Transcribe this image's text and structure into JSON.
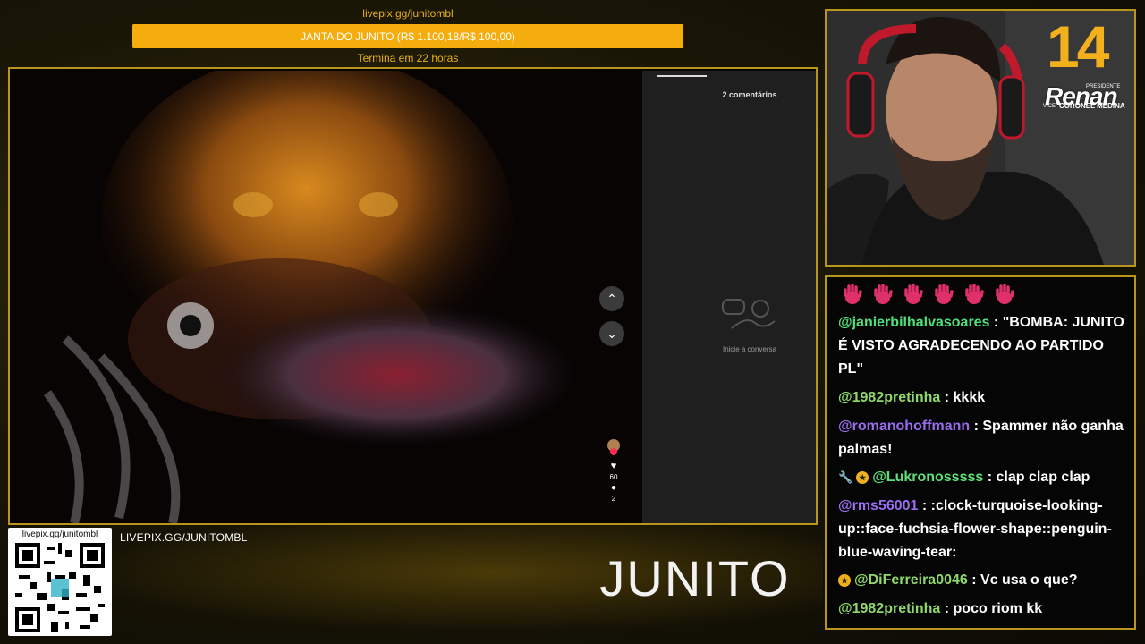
{
  "goal": {
    "url": "livepix.gg/junitombl",
    "title": "JANTA DO JUNITO (R$ 1.100,18/R$ 100,00)",
    "progress_fraction": 1.0,
    "subtitle": "Termina em 22 horas"
  },
  "tiktok": {
    "likes": "60",
    "comments": "2",
    "comments_header": "2 comentários",
    "empty_chat_text": "Inicie a conversa"
  },
  "overlay": {
    "qr_url": "livepix.gg/junitombl",
    "livepix_label": "LIVEPIX.GG/JUNITOMBL",
    "brand": "JUNITO"
  },
  "campaign": {
    "number": "14",
    "role": "PRESIDENTE",
    "name": "Renan",
    "vice_label": "VICE",
    "vice_name": "CORONEL MEDINA"
  },
  "chat": {
    "messages": [
      {
        "user": "@janierbilhalvasoares",
        "color": "#4fe07a",
        "text": "\"BOMBA: JUNITO É VISTO AGRADECENDO AO PARTIDO PL\"",
        "badges": []
      },
      {
        "user": "@1982pretinha",
        "color": "#8fd96a",
        "text": "kkkk",
        "badges": []
      },
      {
        "user": "@romanohoffmann",
        "color": "#9a6df0",
        "text": "Spammer não ganha palmas!",
        "badges": []
      },
      {
        "user": "@Lukronosssss",
        "color": "#5fe07a",
        "text": "clap clap clap",
        "badges": [
          "wrench-icon",
          "star-badge-icon"
        ]
      },
      {
        "user": "@rms56001",
        "color": "#9a6df0",
        "text": ":clock-turquoise-looking-up::face-fuchsia-flower-shape::penguin-blue-waving-tear:",
        "badges": []
      },
      {
        "user": "@DiFerreira0046",
        "color": "#8fd96a",
        "text": "Vc usa o que?",
        "badges": [
          "star-badge-icon"
        ]
      },
      {
        "user": "@1982pretinha",
        "color": "#8fd96a",
        "text": "poco riom kk",
        "badges": []
      }
    ]
  },
  "colors": {
    "accent": "#f5ad0e",
    "frame": "#b8951c",
    "hand_emote": "#e0306a"
  }
}
